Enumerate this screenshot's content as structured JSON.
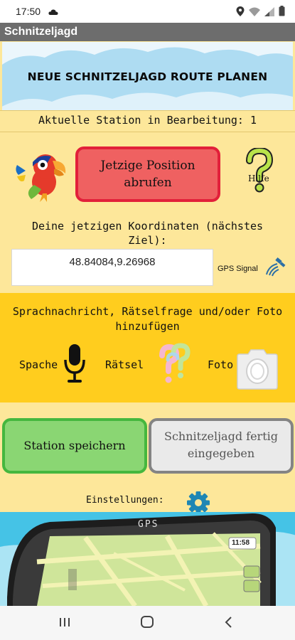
{
  "status_bar": {
    "time": "17:50"
  },
  "app": {
    "title": "Schnitzeljagd"
  },
  "banner": {
    "text": "NEUE SCHNITZELJAGD ROUTE PLANEN"
  },
  "station": {
    "label": "Aktuelle Station in Bearbeitung: 1"
  },
  "position": {
    "button_label": "Jetzige Position abrufen",
    "help_label": "Hilfe"
  },
  "coordinates": {
    "label": "Deine jetzigen Koordinaten (nächstes Ziel):",
    "value": "48.84084,9.26968",
    "gps_label": "GPS Signal"
  },
  "media": {
    "title": "Sprachnachricht, Rätselfrage und/oder Foto hinzufügen",
    "speech_label": "Spache",
    "quiz_label": "Rätsel",
    "photo_label": "Foto"
  },
  "actions": {
    "save_label": "Station speichern",
    "finish_label": "Schnitzeljagd fertig eingegeben"
  },
  "settings": {
    "label": "Einstellungen:"
  },
  "gps_device": {
    "screen_label": "GPS",
    "clock": "11:58"
  },
  "colors": {
    "background": "#fde79a",
    "banner": "#aedcf2",
    "media_section": "#ffcd1e",
    "position_button": "#ef6161",
    "save_button": "#8ad673",
    "finish_button": "#eaeaea",
    "gear": "#1f86b4"
  }
}
